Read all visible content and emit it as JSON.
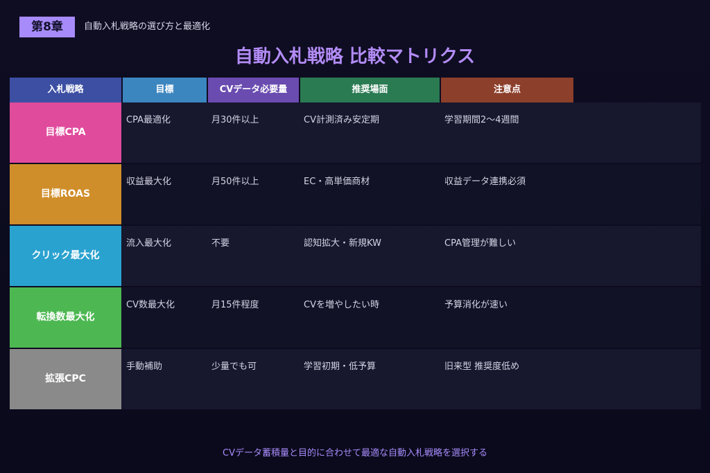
{
  "chapter": {
    "badge": "第8章",
    "subtitle": "自動入札戦略の選び方と最適化"
  },
  "title": "自動入札戦略 比較マトリクス",
  "headers": [
    {
      "label": "入札戦略",
      "color": "#3c4fa3"
    },
    {
      "label": "目標",
      "color": "#3c86c0"
    },
    {
      "label": "CVデータ必要量",
      "color": "#6a4cb0"
    },
    {
      "label": "推奨場面",
      "color": "#2a7a52"
    },
    {
      "label": "注意点",
      "color": "#8c3f2a"
    }
  ],
  "rows": [
    {
      "name": "目標CPA",
      "color": "#e04b9c",
      "goal": "CPA最適化",
      "cv": "月30件以上",
      "scene": "CV計測済み安定期",
      "note": "学習期間2〜4週間"
    },
    {
      "name": "目標ROAS",
      "color": "#d08e2a",
      "goal": "収益最大化",
      "cv": "月50件以上",
      "scene": "EC・高単価商材",
      "note": "収益データ連携必須"
    },
    {
      "name": "クリック最大化",
      "color": "#2aa2cf",
      "goal": "流入最大化",
      "cv": "不要",
      "scene": "認知拡大・新規KW",
      "note": "CPA管理が難しい"
    },
    {
      "name": "転換数最大化",
      "color": "#4db852",
      "goal": "CV数最大化",
      "cv": "月15件程度",
      "scene": "CVを増やしたい時",
      "note": "予算消化が速い"
    },
    {
      "name": "拡張CPC",
      "color": "#8a8a8a",
      "goal": "手動補助",
      "cv": "少量でも可",
      "scene": "学習初期・低予算",
      "note": "旧来型 推奨度低め"
    }
  ],
  "footer": "CVデータ蓄積量と目的に合わせて最適な自動入札戦略を選択する"
}
